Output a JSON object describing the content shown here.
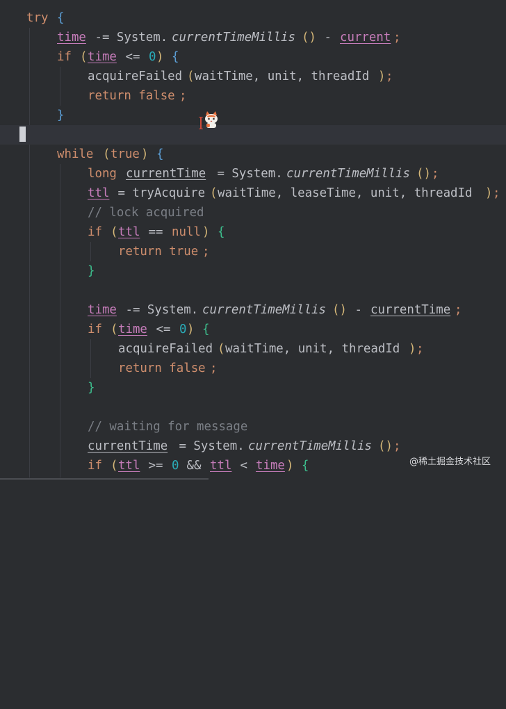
{
  "colors": {
    "background": "#2b2d30",
    "keyword": "#cf8e6d",
    "field": "#c77dbb",
    "number": "#2aacb8",
    "comment": "#7a7e85",
    "text": "#bcbec4"
  },
  "code": {
    "l1": {
      "kw": "try",
      "brace": "{"
    },
    "l2": {
      "a": "time",
      "b": " -= System.",
      "c": "currentTimeMillis",
      "d": "()",
      "e": " - ",
      "f": "current",
      "g": ";"
    },
    "l3": {
      "kw": "if",
      "p1": "(",
      "v": "time",
      "op": " <= ",
      "n": "0",
      "p2": ")",
      "br": "{"
    },
    "l4": {
      "fn": "acquireFailed",
      "p1": "(",
      "args": "waitTime, unit, threadId",
      "p2": ")",
      "semi": ";"
    },
    "l5": {
      "kw": "return false",
      "semi": ";"
    },
    "l6": {
      "br": "}"
    },
    "l8": {
      "kw": "while",
      "p1": "(",
      "v": "true",
      "p2": ")",
      "br": "{"
    },
    "l9": {
      "kw": "long",
      "v": "currentTime",
      "b": " = System.",
      "c": "currentTimeMillis",
      "d": "()",
      "g": ";"
    },
    "l10": {
      "v": "ttl",
      "b": " = tryAcquire",
      "p1": "(",
      "args": "waitTime, leaseTime, unit, threadId",
      "p2": ")",
      "g": ";"
    },
    "l11": {
      "cmt": "// lock acquired"
    },
    "l12": {
      "kw": "if",
      "p1": "(",
      "v": "ttl",
      "op": " == ",
      "kw2": "null",
      "p2": ")",
      "br": "{"
    },
    "l13": {
      "kw": "return true",
      "semi": ";"
    },
    "l14": {
      "br": "}"
    },
    "l16": {
      "a": "time",
      "b": " -= System.",
      "c": "currentTimeMillis",
      "d": "()",
      "e": " - ",
      "f": "currentTime",
      "g": ";"
    },
    "l17": {
      "kw": "if",
      "p1": "(",
      "v": "time",
      "op": " <= ",
      "n": "0",
      "p2": ")",
      "br": "{"
    },
    "l18": {
      "fn": "acquireFailed",
      "p1": "(",
      "args": "waitTime, unit, threadId",
      "p2": ")",
      "semi": ";"
    },
    "l19": {
      "kw": "return false",
      "semi": ";"
    },
    "l20": {
      "br": "}"
    },
    "l22": {
      "cmt": "// waiting for message"
    },
    "l23": {
      "a": "currentTime",
      "b": " = System.",
      "c": "currentTimeMillis",
      "d": "()",
      "g": ";"
    },
    "l24": {
      "kw": "if",
      "p1": "(",
      "v": "ttl",
      "op": " >= ",
      "n": "0",
      "and": " && ",
      "v2": "ttl",
      "lt": " < ",
      "v3": "time",
      "p2": ")",
      "br": "{"
    }
  },
  "watermark": "@稀土掘金技术社区"
}
